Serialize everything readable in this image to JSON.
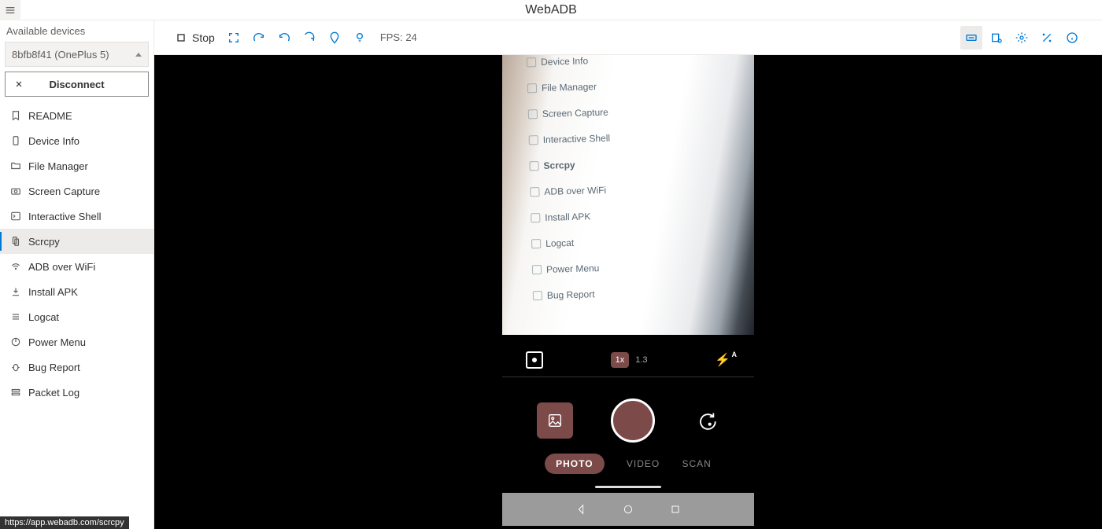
{
  "app": {
    "title": "WebADB"
  },
  "sidebar": {
    "header": "Available devices",
    "device": "8bfb8f41 (OnePlus 5)",
    "disconnect": "Disconnect",
    "items": [
      {
        "label": "README",
        "icon": "bookmark"
      },
      {
        "label": "Device Info",
        "icon": "phone"
      },
      {
        "label": "File Manager",
        "icon": "folder"
      },
      {
        "label": "Screen Capture",
        "icon": "camera"
      },
      {
        "label": "Interactive Shell",
        "icon": "terminal"
      },
      {
        "label": "Scrcpy",
        "icon": "mirror",
        "active": true
      },
      {
        "label": "ADB over WiFi",
        "icon": "wifi"
      },
      {
        "label": "Install APK",
        "icon": "download"
      },
      {
        "label": "Logcat",
        "icon": "list"
      },
      {
        "label": "Power Menu",
        "icon": "power"
      },
      {
        "label": "Bug Report",
        "icon": "bug"
      },
      {
        "label": "Packet Log",
        "icon": "packet"
      }
    ]
  },
  "toolbar": {
    "stop": "Stop",
    "fps": "FPS: 24"
  },
  "camera": {
    "zoom_active": "1x",
    "zoom_alt": "1.3",
    "modes": {
      "photo": "PHOTO",
      "video": "VIDEO",
      "scan": "SCAN"
    },
    "mirrored_list": [
      "Device Info",
      "File Manager",
      "Screen Capture",
      "Interactive Shell",
      "Scrcpy",
      "ADB over WiFi",
      "Install APK",
      "Logcat",
      "Power Menu",
      "Bug Report"
    ]
  },
  "status": {
    "url": "https://app.webadb.com/scrcpy"
  }
}
